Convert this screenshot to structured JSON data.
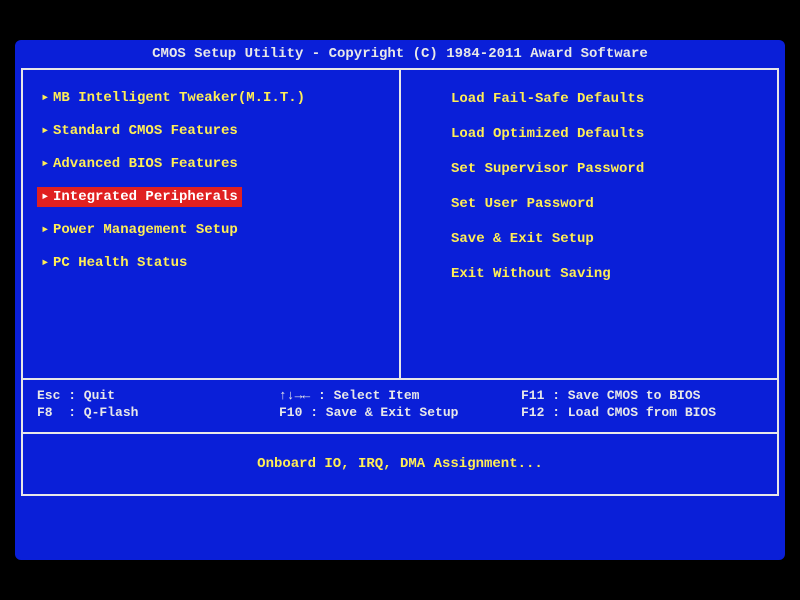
{
  "title": "CMOS Setup Utility - Copyright (C) 1984-2011 Award Software",
  "arrow": "▸",
  "left_menu": [
    {
      "label": "MB Intelligent Tweaker(M.I.T.)",
      "has_arrow": true,
      "selected": false
    },
    {
      "label": "Standard CMOS Features",
      "has_arrow": true,
      "selected": false
    },
    {
      "label": "Advanced BIOS Features",
      "has_arrow": true,
      "selected": false
    },
    {
      "label": "Integrated Peripherals",
      "has_arrow": true,
      "selected": true
    },
    {
      "label": "Power Management Setup",
      "has_arrow": true,
      "selected": false
    },
    {
      "label": "PC Health Status",
      "has_arrow": true,
      "selected": false
    }
  ],
  "right_menu": [
    {
      "label": "Load Fail-Safe Defaults"
    },
    {
      "label": "Load Optimized Defaults"
    },
    {
      "label": "Set Supervisor Password"
    },
    {
      "label": "Set User Password"
    },
    {
      "label": "Save & Exit Setup"
    },
    {
      "label": "Exit Without Saving"
    }
  ],
  "help": {
    "r1c1": "Esc : Quit",
    "r1c2": "↑↓→← : Select Item",
    "r1c3": "F11 : Save CMOS to BIOS",
    "r2c1": "F8  : Q-Flash",
    "r2c2": "F10 : Save & Exit Setup",
    "r2c3": "F12 : Load CMOS from BIOS"
  },
  "description": "Onboard IO, IRQ, DMA Assignment..."
}
